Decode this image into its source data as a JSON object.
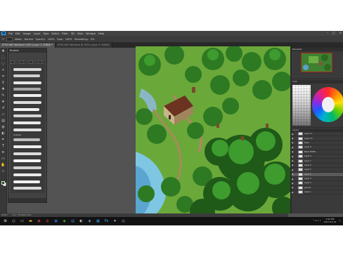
{
  "app": {
    "menu": [
      "File",
      "Edit",
      "Image",
      "Layer",
      "Type",
      "Select",
      "Filter",
      "3D",
      "View",
      "Window",
      "Help"
    ],
    "logo": "Ps",
    "window_controls": [
      "–",
      "▢",
      "✕"
    ]
  },
  "options_bar": {
    "items": [
      "Mode:",
      "Normal",
      "Opacity:",
      "100%",
      "Flow:",
      "100%",
      "Smoothing:",
      "0%"
    ]
  },
  "tabs": [
    {
      "label": "KTHS MAP WAGbord 100% (Layer 3, RGB/8) *",
      "active": true
    },
    {
      "label": "KTHS MAP WAGbord @ 100% (Layer 4, RGB/8)",
      "active": false
    }
  ],
  "brush_panel": {
    "title": "Brushes",
    "group_label": "Grasses"
  },
  "panels": {
    "navigator_title": "Navigator",
    "color_title": "Color",
    "layers_title": "Layers"
  },
  "layers": [
    {
      "name": "Layer 11",
      "selected": false
    },
    {
      "name": "Layer 10",
      "selected": false
    },
    {
      "name": "trees",
      "selected": false
    },
    {
      "name": "Layer 9",
      "selected": false
    },
    {
      "name": "BACK TREES",
      "selected": false
    },
    {
      "name": "Layer 8",
      "selected": false
    },
    {
      "name": "Layer 7",
      "selected": false
    },
    {
      "name": "Layer 6",
      "selected": false
    },
    {
      "name": "Layer 5",
      "selected": false
    },
    {
      "name": "Layer 4",
      "selected": true
    },
    {
      "name": "Layer 3",
      "selected": false
    },
    {
      "name": "Layer 2",
      "selected": false
    },
    {
      "name": "ground",
      "selected": false
    },
    {
      "name": "Layer 1",
      "selected": false
    }
  ],
  "status": {
    "zoom": "100%",
    "doc": "Doc: 35.6M/1.20G"
  },
  "taskbar": {
    "time": "3:56 PM",
    "date": "2017-03-19"
  },
  "colors": {
    "fg": "#1d4d1e",
    "accent": "#31a8ff"
  }
}
